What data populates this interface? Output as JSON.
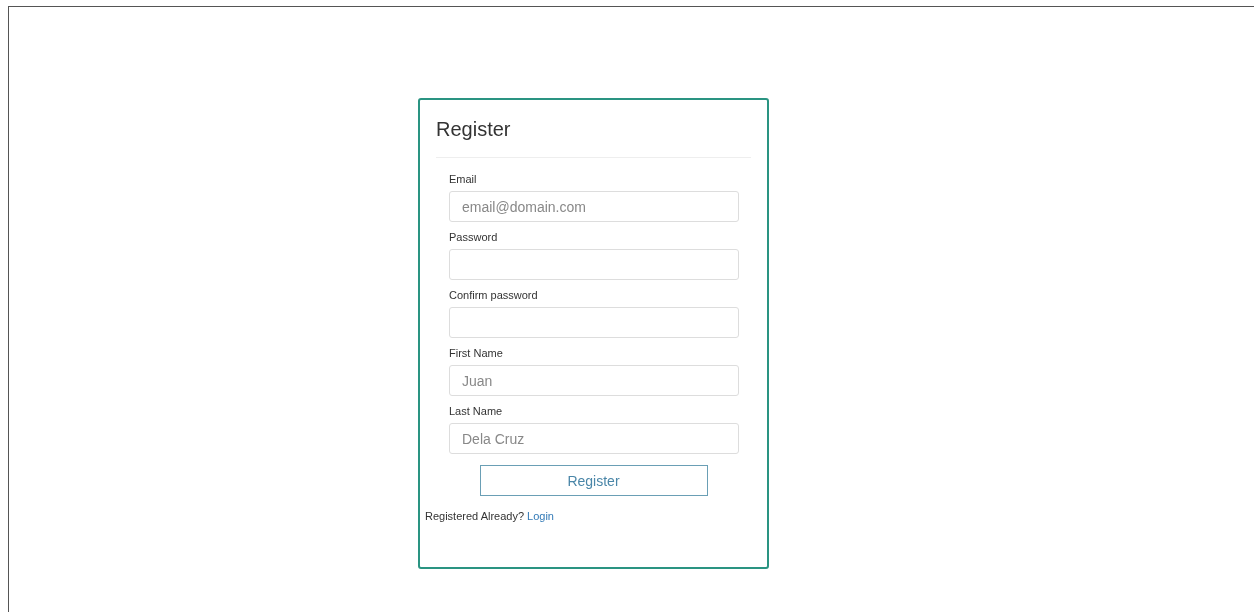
{
  "form": {
    "title": "Register",
    "fields": [
      {
        "label": "Email",
        "placeholder": "email@domain.com"
      },
      {
        "label": "Password"
      },
      {
        "label": "Confirm password"
      },
      {
        "label": "First Name",
        "placeholder": "Juan"
      },
      {
        "label": "Last Name",
        "placeholder": "Dela Cruz"
      }
    ],
    "submit": "Register",
    "footer": {
      "text": "Registered Already?",
      "link": "Login"
    }
  }
}
